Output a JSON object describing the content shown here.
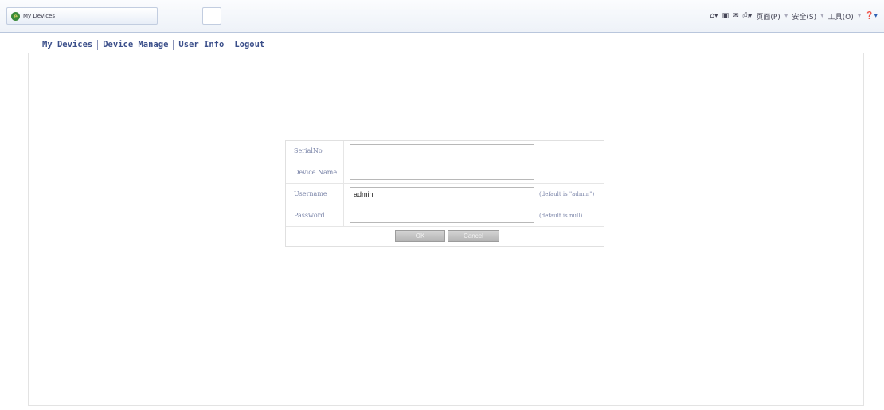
{
  "browser": {
    "tab_title": "My Devices",
    "command_bar": [
      "页面(P)",
      "安全(S)",
      "工具(O)"
    ]
  },
  "nav": {
    "items": [
      "My Devices",
      "Device Manage",
      "User Info",
      "Logout"
    ]
  },
  "form": {
    "fields": [
      {
        "label": "SerialNo",
        "value": "",
        "hint": ""
      },
      {
        "label": "Device Name",
        "value": "",
        "hint": ""
      },
      {
        "label": "Username",
        "value": "admin",
        "hint": "(default is \"admin\")"
      },
      {
        "label": "Password",
        "value": "",
        "hint": "(default is null)"
      }
    ],
    "ok_label": "OK",
    "cancel_label": "Cancel"
  }
}
